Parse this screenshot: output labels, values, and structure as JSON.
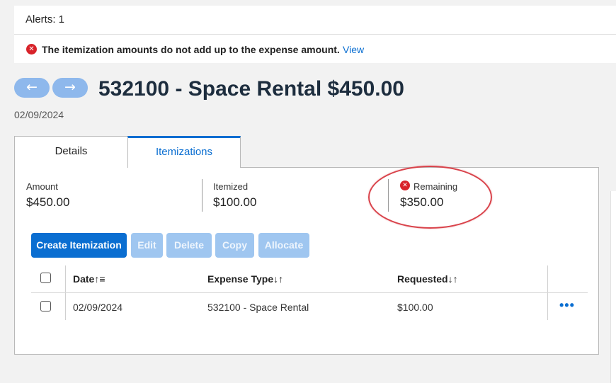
{
  "alerts": {
    "title": "Alerts: 1",
    "message": "The itemization amounts do not add up to the expense amount.",
    "link": "View"
  },
  "nav": {
    "prev_icon": "←",
    "next_icon": "→"
  },
  "page": {
    "title": "532100 - Space Rental $450.00",
    "date": "02/09/2024"
  },
  "tabs": [
    {
      "label": "Details",
      "active": false
    },
    {
      "label": "Itemizations",
      "active": true
    }
  ],
  "summary": {
    "amount": {
      "label": "Amount",
      "value": "$450.00"
    },
    "itemized": {
      "label": "Itemized",
      "value": "$100.00"
    },
    "remaining": {
      "label": "Remaining",
      "value": "$350.00",
      "status": "error"
    }
  },
  "toolbar": {
    "create": "Create Itemization",
    "edit": "Edit",
    "delete": "Delete",
    "copy": "Copy",
    "allocate": "Allocate"
  },
  "table": {
    "columns": [
      "Date↑≡",
      "Expense Type↓↑",
      "Requested↓↑"
    ],
    "rows": [
      {
        "date": "02/09/2024",
        "expense_type": "532100 - Space Rental",
        "requested": "$100.00"
      }
    ],
    "more": "•••"
  },
  "icons": {
    "error": "✕"
  },
  "colors": {
    "accent": "#0a6ed1",
    "error": "#d8232a",
    "annotation": "#d9434b"
  }
}
